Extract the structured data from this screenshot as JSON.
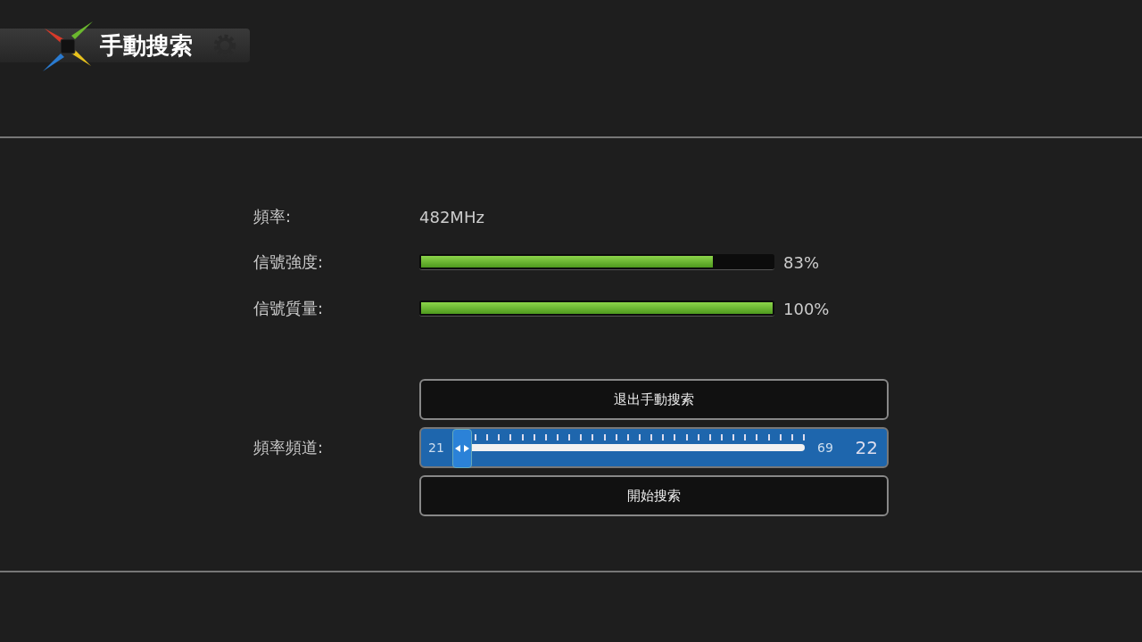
{
  "header": {
    "title": "手動搜索"
  },
  "rows": [
    {
      "kind": "text",
      "label": "頻率:",
      "value": "482MHz"
    },
    {
      "kind": "meter",
      "label": "信號強度:",
      "level": 0.83,
      "reading": "83%"
    },
    {
      "kind": "meter",
      "label": "信號質量:",
      "level": 1.0,
      "reading": "100%"
    }
  ],
  "exit_button": "退出手動搜索",
  "channel": {
    "label": "頻率頻道:",
    "min": "21",
    "max": "69",
    "value": "22",
    "level": 0.02
  },
  "start_button": "開始搜索"
}
